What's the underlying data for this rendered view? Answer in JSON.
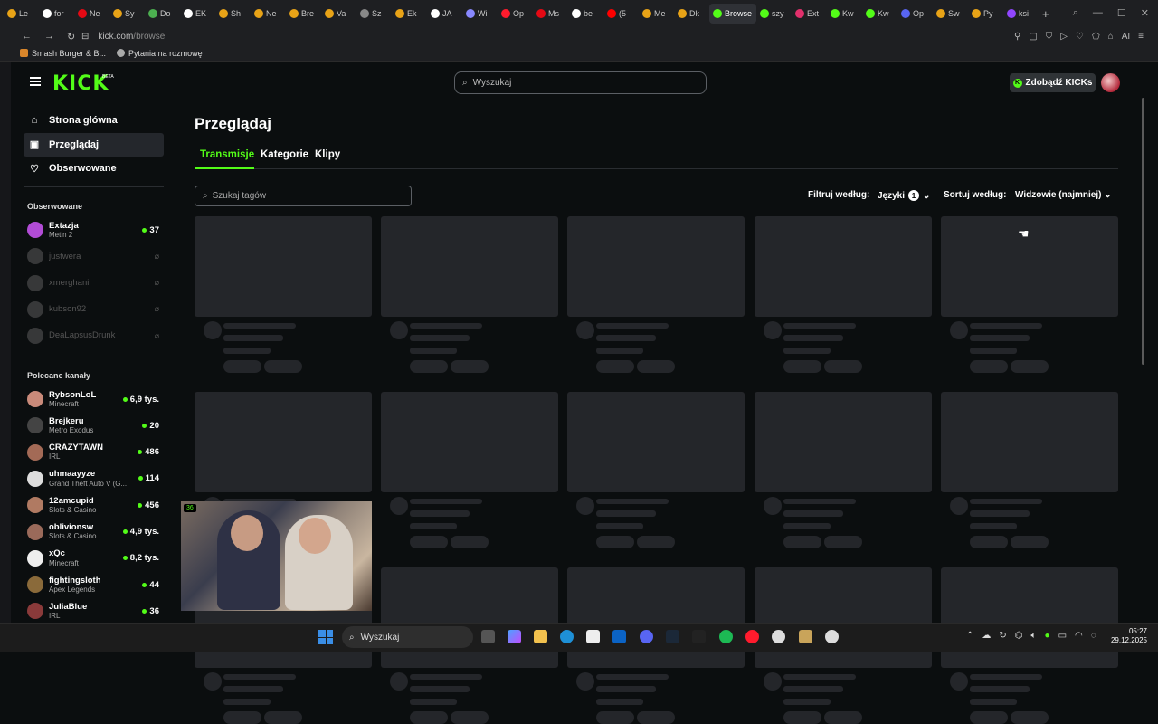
{
  "browser": {
    "tabs": [
      {
        "label": "Le",
        "color": "#e8a317"
      },
      {
        "label": "for",
        "color": "#ffffff"
      },
      {
        "label": "Ne",
        "color": "#e50914"
      },
      {
        "label": "Sy",
        "color": "#e8a317"
      },
      {
        "label": "Do",
        "color": "#4caf50"
      },
      {
        "label": "EK",
        "color": "#ffffff"
      },
      {
        "label": "Sh",
        "color": "#e8a317"
      },
      {
        "label": "Ne",
        "color": "#e8a317"
      },
      {
        "label": "Bre",
        "color": "#e8a317"
      },
      {
        "label": "Va",
        "color": "#e8a317"
      },
      {
        "label": "Sz",
        "color": "#888888"
      },
      {
        "label": "Ek",
        "color": "#e8a317"
      },
      {
        "label": "JA",
        "color": "#ffffff"
      },
      {
        "label": "Wi",
        "color": "#8888ff"
      },
      {
        "label": "Op",
        "color": "#ff1b2d"
      },
      {
        "label": "Ms",
        "color": "#e50914"
      },
      {
        "label": "be",
        "color": "#ffffff"
      },
      {
        "label": "(5",
        "color": "#ff0000"
      },
      {
        "label": "Me",
        "color": "#e8a317"
      },
      {
        "label": "Dk",
        "color": "#e8a317"
      },
      {
        "label": "Browse",
        "color": "#53fc18",
        "active": true
      },
      {
        "label": "szy",
        "color": "#53fc18"
      },
      {
        "label": "Ext",
        "color": "#e1306c"
      },
      {
        "label": "Kw",
        "color": "#53fc18"
      },
      {
        "label": "Kw",
        "color": "#53fc18"
      },
      {
        "label": "Op",
        "color": "#5865f2"
      },
      {
        "label": "Sw",
        "color": "#e8a317"
      },
      {
        "label": "Py",
        "color": "#e8a317"
      },
      {
        "label": "ksi",
        "color": "#9146ff"
      }
    ],
    "new_tab": "+",
    "url_host": "kick.com",
    "url_path": "/browse",
    "bookmarks": [
      "Smash Burger & B...",
      "Pytania na rozmowę"
    ]
  },
  "header": {
    "logo": "KICK",
    "logo_tag": "BETA",
    "search_placeholder": "Wyszukaj",
    "kicks_button": "Zdobądź KICKs"
  },
  "sidebar": {
    "nav": [
      {
        "label": "Strona główna",
        "icon": "home-icon",
        "glyph": "⌂"
      },
      {
        "label": "Przeglądaj",
        "icon": "browse-icon",
        "glyph": "▣",
        "active": true
      },
      {
        "label": "Obserwowane",
        "icon": "heart-icon",
        "glyph": "♡"
      }
    ],
    "followed_title": "Obserwowane",
    "followed": [
      {
        "name": "Extazja",
        "category": "Metin 2",
        "viewers": "37",
        "live": true,
        "color": "#b24cd6"
      },
      {
        "name": "justwera",
        "live": false
      },
      {
        "name": "xmerghani",
        "live": false
      },
      {
        "name": "kubson92",
        "live": false
      },
      {
        "name": "DeaLapsusDrunk",
        "live": false
      }
    ],
    "recommended_title": "Polecane kanały",
    "recommended": [
      {
        "name": "RybsonLoL",
        "category": "Minecraft",
        "viewers": "6,9 tys.",
        "color": "#c98a7a"
      },
      {
        "name": "Brejkeru",
        "category": "Metro Exodus",
        "viewers": "20",
        "color": "#444444"
      },
      {
        "name": "CRAZYTAWN",
        "category": "IRL",
        "viewers": "486",
        "color": "#a36a56"
      },
      {
        "name": "uhmaayyze",
        "category": "Grand Theft Auto V (G...",
        "viewers": "114",
        "color": "#dddddd"
      },
      {
        "name": "12amcupid",
        "category": "Slots & Casino",
        "viewers": "456",
        "color": "#b07a62"
      },
      {
        "name": "oblivionsw",
        "category": "Slots & Casino",
        "viewers": "4,9 tys.",
        "color": "#9a6a5a"
      },
      {
        "name": "xQc",
        "category": "Minecraft",
        "viewers": "8,2 tys.",
        "color": "#eeeeee"
      },
      {
        "name": "fightingsloth",
        "category": "Apex Legends",
        "viewers": "44",
        "color": "#8a6a3a"
      },
      {
        "name": "JuliaBlue",
        "category": "IRL",
        "viewers": "36",
        "color": "#8a3a3a"
      }
    ]
  },
  "main": {
    "title": "Przeglądaj",
    "tabs": [
      "Transmisje",
      "Kategorie",
      "Klipy"
    ],
    "tag_search_placeholder": "Szukaj tagów",
    "filter_label": "Filtruj według:",
    "languages_label": "Języki",
    "languages_count": "1",
    "sort_label": "Sortuj według:",
    "sort_value": "Widzowie (najmniej)"
  },
  "mini_player": {
    "badge": "36"
  },
  "taskbar": {
    "search": "Wyszukaj",
    "time": "05:27",
    "date": "29.12.2025"
  }
}
